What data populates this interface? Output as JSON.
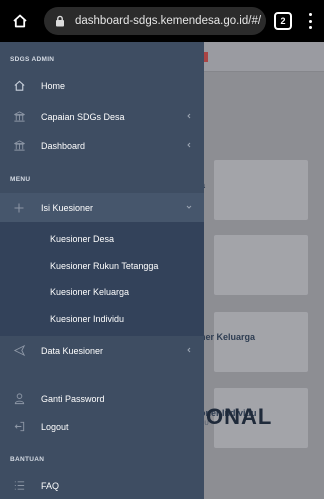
{
  "browser": {
    "url": "dashboard-sdgs.kemendesa.go.id/#/",
    "tab_count": "2"
  },
  "sidebar": {
    "sections": {
      "admin": "SDGS ADMIN",
      "menu": "MENU",
      "bantuan": "BANTUAN"
    },
    "items": {
      "home": "Home",
      "capaian": "Capaian SDGs Desa",
      "dashboard": "Dashboard",
      "isi_kuesioner": "Isi Kuesioner",
      "data_kuesioner": "Data Kuesioner",
      "ganti_password": "Ganti Password",
      "logout": "Logout",
      "faq": "FAQ"
    },
    "submenu": [
      "Kuesioner Desa",
      "Kuesioner Rukun Tetangga",
      "Kuesioner Keluarga",
      "Kuesioner Individu"
    ]
  },
  "page": {
    "cards": [
      {
        "title": "a",
        "sub": ""
      },
      {
        "title": "r",
        "sub": ""
      },
      {
        "title": "ner Keluarga",
        "sub": "A"
      },
      {
        "title": "oner Individu",
        "sub": "DU"
      }
    ],
    "big_text": "ONAL"
  },
  "colors": {
    "sidebar_bg": "#3e4d62",
    "submenu_bg": "#33425a",
    "active_item_bg": "#46566c"
  }
}
